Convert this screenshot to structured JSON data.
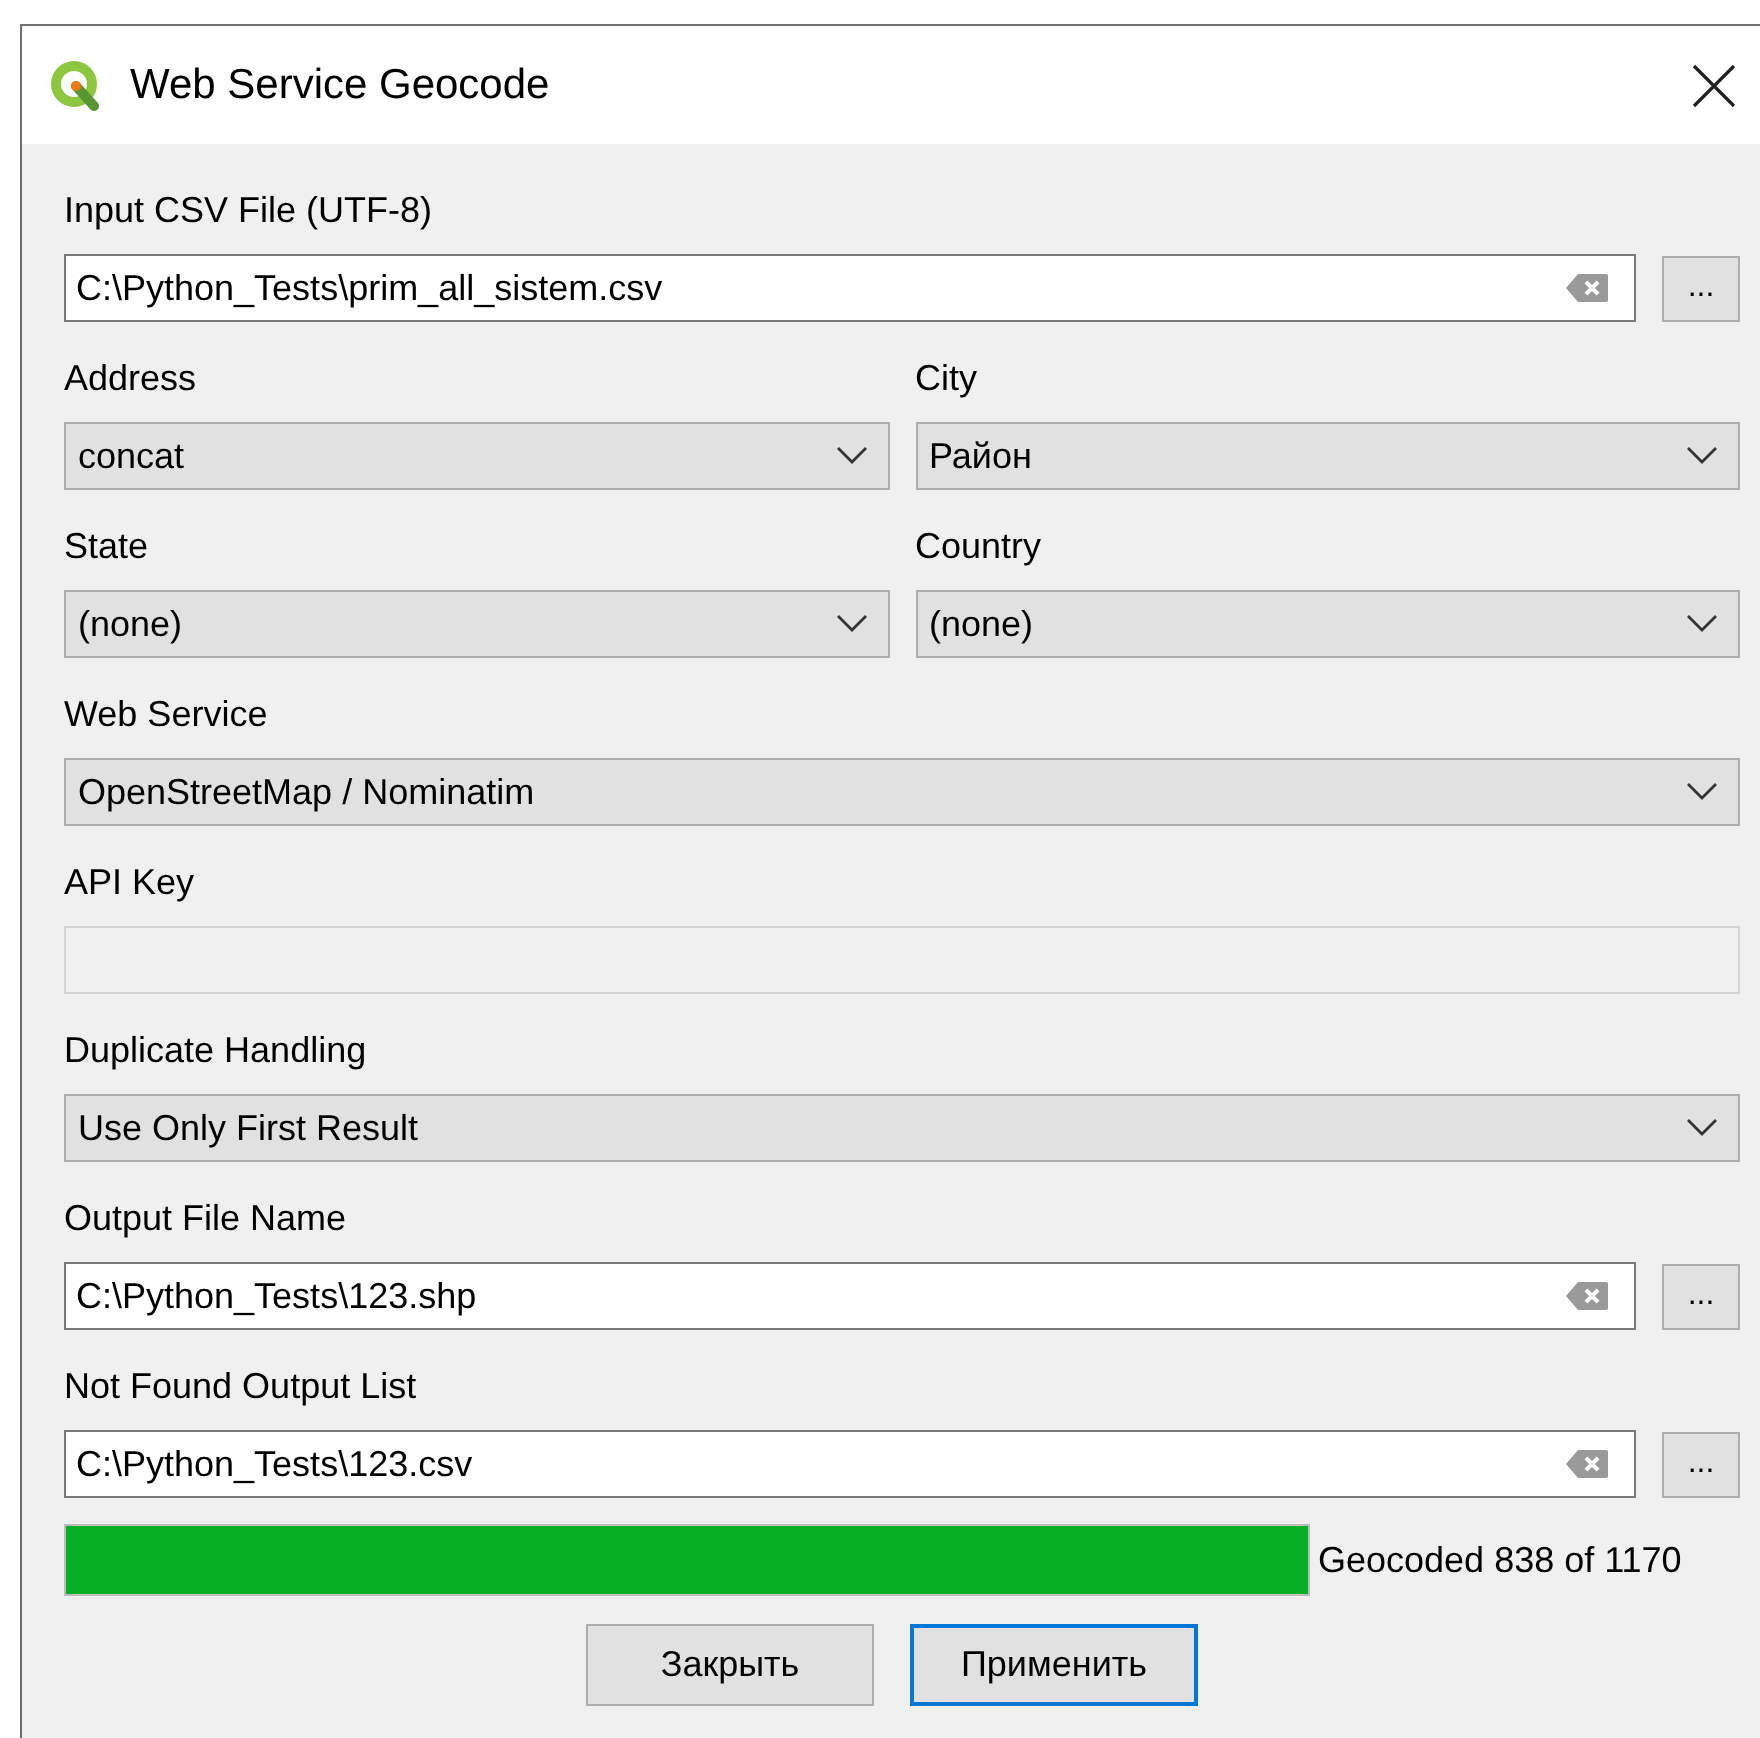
{
  "window": {
    "title": "Web Service Geocode"
  },
  "rows": [
    [
      {
        "label": "Input CSV File (UTF-8)",
        "kind": "file",
        "value": "C:\\Python_Tests\\prim_all_sistem.csv",
        "browse": "..."
      }
    ],
    [
      {
        "label": "Address",
        "kind": "combo",
        "value": "concat"
      },
      {
        "label": "City",
        "kind": "combo",
        "value": "Район"
      }
    ],
    [
      {
        "label": "State",
        "kind": "combo",
        "value": "(none)"
      },
      {
        "label": "Country",
        "kind": "combo",
        "value": "(none)"
      }
    ],
    [
      {
        "label": "Web Service",
        "kind": "combo",
        "value": "OpenStreetMap / Nominatim"
      }
    ],
    [
      {
        "label": "API Key",
        "kind": "text",
        "disabled": true
      }
    ],
    [
      {
        "label": "Duplicate Handling",
        "kind": "combo",
        "value": "Use Only First Result"
      }
    ],
    [
      {
        "label": "Output File Name",
        "kind": "file",
        "value": "C:\\Python_Tests\\123.shp",
        "browse": "..."
      }
    ],
    [
      {
        "label": "Not Found Output List",
        "kind": "file",
        "value": "C:\\Python_Tests\\123.csv",
        "browse": "..."
      }
    ]
  ],
  "progress": {
    "level": 1,
    "text": "Geocoded 838 of 1170"
  },
  "buttons": [
    {
      "label": "Закрыть",
      "focused": false
    },
    {
      "label": "Применить",
      "focused": true
    }
  ]
}
